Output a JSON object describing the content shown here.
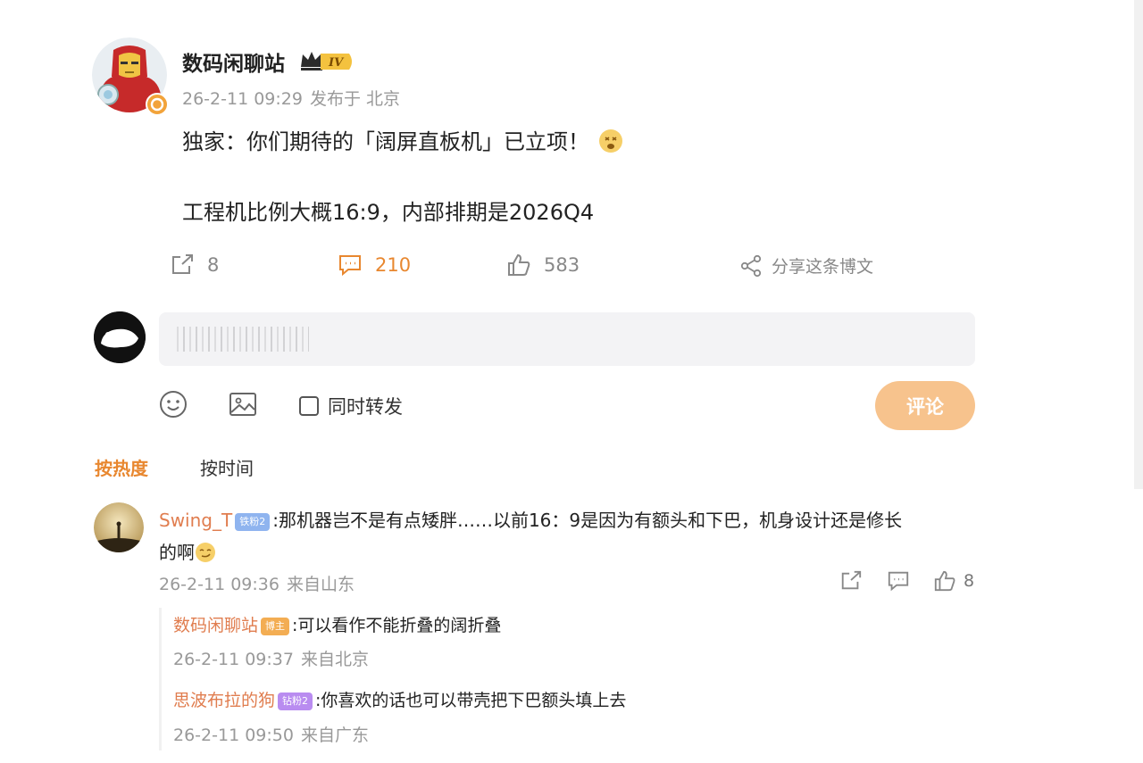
{
  "post": {
    "author": "数码闲聊站",
    "level_badge": "IV",
    "date": "26-2-11 09:29",
    "location": "发布于 北京",
    "text_line1": "独家：你们期待的「阔屏直板机」已立项！",
    "text_line2": "工程机比例大概16:9，内部排期是2026Q4",
    "reposts": "8",
    "comments": "210",
    "likes": "583",
    "share_label": "分享这条博文"
  },
  "composer": {
    "placeholder": "",
    "repost_label": "同时转发",
    "submit_label": "评论"
  },
  "sort": {
    "hot": "按热度",
    "time": "按时间"
  },
  "comment": {
    "user": "Swing_T",
    "badge": "铁粉2",
    "text_line1": ":那机器岂不是有点矮胖……以前16：9是因为有额头和下巴，机身设计还是修长",
    "text_line2": "的啊",
    "date": "26-2-11 09:36",
    "location": "来自山东",
    "likes": "8",
    "replies": [
      {
        "user": "数码闲聊站",
        "badge": "博主",
        "text": ":可以看作不能折叠的阔折叠",
        "date": "26-2-11 09:37",
        "location": "来自北京"
      },
      {
        "user": "思波布拉的狗",
        "badge": "钻粉2",
        "text": ":你喜欢的话也可以带壳把下巴额头填上去",
        "date": "26-2-11 09:50",
        "location": "来自广东"
      }
    ]
  },
  "colors": {
    "accent": "#e8872f",
    "username": "#e07d4f",
    "submit": "#f7c38d"
  }
}
